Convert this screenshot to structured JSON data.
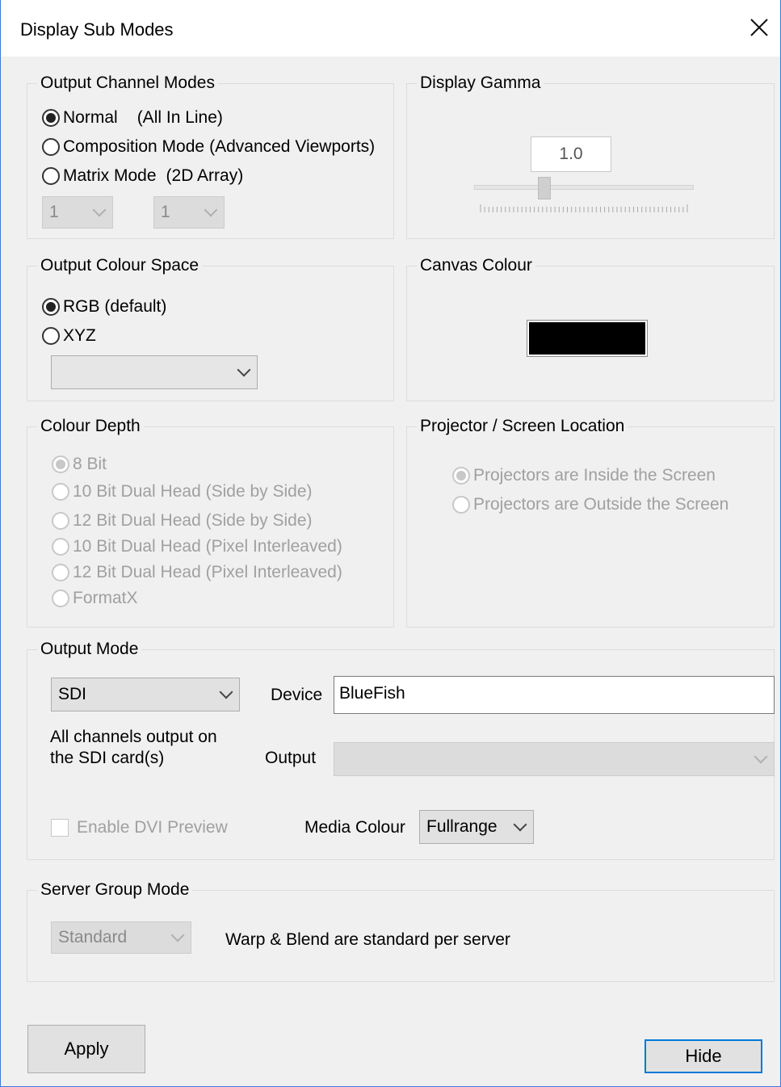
{
  "window": {
    "title": "Display Sub Modes",
    "close_icon": "close-icon"
  },
  "output_channel_modes": {
    "legend": "Output Channel Modes",
    "options": [
      {
        "label": "Normal",
        "note": "(All In Line)",
        "checked": true
      },
      {
        "label": "Composition Mode",
        "note": "(Advanced Viewports)",
        "checked": false
      },
      {
        "label": "Matrix Mode",
        "note": "(2D Array)",
        "checked": false
      }
    ],
    "matrix_cols": "1",
    "matrix_rows": "1"
  },
  "display_gamma": {
    "legend": "Display Gamma",
    "value": "1.0",
    "slider_fraction": 0.2
  },
  "output_colour_space": {
    "legend": "Output Colour Space",
    "options": [
      {
        "label": "RGB (default)",
        "checked": true
      },
      {
        "label": "XYZ",
        "checked": false
      }
    ],
    "xyz_select": ""
  },
  "canvas_colour": {
    "legend": "Canvas Colour",
    "color": "#000000"
  },
  "colour_depth": {
    "legend": "Colour Depth",
    "options": [
      {
        "label": "8 Bit",
        "checked": true
      },
      {
        "label": "10 Bit Dual Head (Side by Side)",
        "checked": false
      },
      {
        "label": "12 Bit Dual Head (Side by Side)",
        "checked": false
      },
      {
        "label": "10 Bit Dual Head (Pixel Interleaved)",
        "checked": false
      },
      {
        "label": "12 Bit Dual Head (Pixel Interleaved)",
        "checked": false
      },
      {
        "label": "FormatX",
        "checked": false
      }
    ]
  },
  "projector_location": {
    "legend": "Projector / Screen Location",
    "options": [
      {
        "label": "Projectors are Inside the Screen",
        "checked": true
      },
      {
        "label": "Projectors are Outside the Screen",
        "checked": false
      }
    ]
  },
  "output_mode": {
    "legend": "Output Mode",
    "mode_value": "SDI",
    "device_label": "Device",
    "device_value": "BlueFish",
    "description_line1": "All channels output on",
    "description_line2": "the SDI card(s)",
    "output_label": "Output",
    "output_value": "",
    "dvi_preview_label": "Enable DVI Preview",
    "media_colour_label": "Media Colour",
    "media_colour_value": "Fullrange"
  },
  "server_group_mode": {
    "legend": "Server Group Mode",
    "mode_value": "Standard",
    "description": "Warp & Blend are standard per server"
  },
  "buttons": {
    "apply": "Apply",
    "hide": "Hide"
  }
}
